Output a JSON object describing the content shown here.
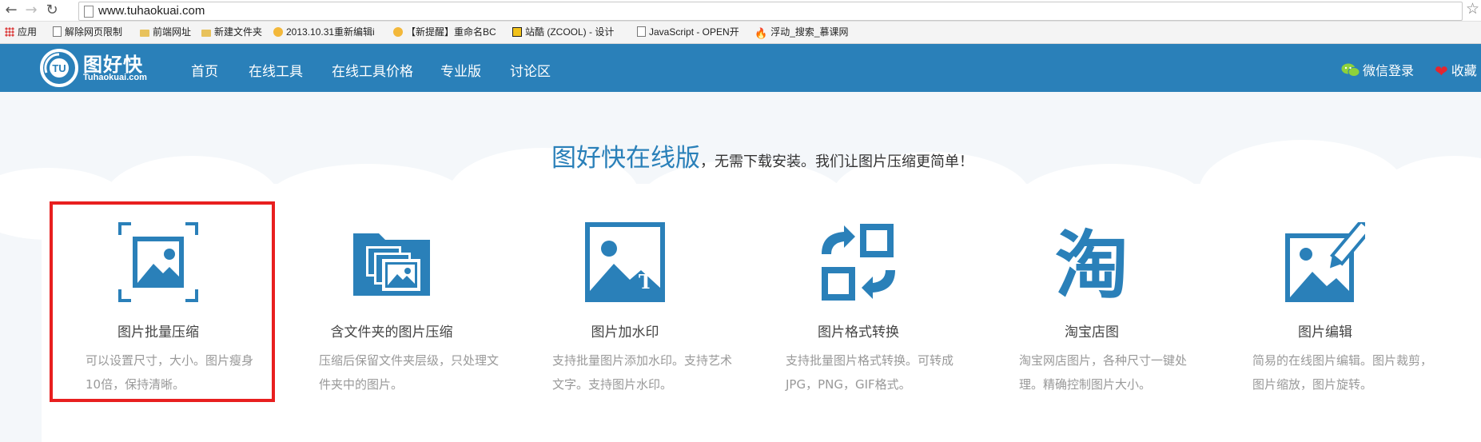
{
  "browser": {
    "url": "www.tuhaokuai.com",
    "bookmarks": [
      {
        "label": "应用",
        "icon": "apps-icon"
      },
      {
        "label": "解除网页限制",
        "icon": "page-icon"
      },
      {
        "label": "前端网址",
        "icon": "folder-icon"
      },
      {
        "label": "新建文件夹",
        "icon": "folder-icon"
      },
      {
        "label": "2013.10.31重新编辑i",
        "icon": "sun-icon"
      },
      {
        "label": "【新提醒】重命名BC",
        "icon": "sun-icon"
      },
      {
        "label": "站酷 (ZCOOL) - 设计",
        "icon": "zcool-icon"
      },
      {
        "label": "JavaScript - OPEN开",
        "icon": "page-icon"
      },
      {
        "label": "浮动_搜索_慕课网",
        "icon": "fire-icon"
      }
    ]
  },
  "header": {
    "logo_cn": "图好快",
    "logo_en": "Tuhaokuai.com",
    "logo_badge": "TU",
    "menu": [
      "首页",
      "在线工具",
      "在线工具价格",
      "专业版",
      "讨论区"
    ],
    "wechat_login": "微信登录",
    "favorite": "收藏"
  },
  "hero": {
    "title": "图好快在线版",
    "subtitle": "，无需下载安装。我们让图片压缩更简单！"
  },
  "features": [
    {
      "title": "图片批量压缩",
      "desc": "可以设置尺寸，大小。图片瘦身10倍，保持清晰。",
      "icon": "batch-compress-icon"
    },
    {
      "title": "含文件夹的图片压缩",
      "desc": "压缩后保留文件夹层级，只处理文件夹中的图片。",
      "icon": "folder-compress-icon"
    },
    {
      "title": "图片加水印",
      "desc": "支持批量图片添加水印。支持艺术文字。支持图片水印。",
      "icon": "watermark-icon"
    },
    {
      "title": "图片格式转换",
      "desc": "支持批量图片格式转换。可转成JPG，PNG，GIF格式。",
      "icon": "format-convert-icon"
    },
    {
      "title": "淘宝店图",
      "desc": "淘宝网店图片，各种尺寸一键处理。精确控制图片大小。",
      "icon": "taobao-icon"
    },
    {
      "title": "图片编辑",
      "desc": "简易的在线图片编辑。图片裁剪，图片缩放，图片旋转。",
      "icon": "image-edit-icon"
    }
  ],
  "feature_icon_glyphs": {
    "watermark_letter": "T",
    "taobao_char": "淘"
  },
  "colors": {
    "brand": "#2a80b9",
    "highlight": "#e81f1f",
    "muted_text": "#999999"
  }
}
